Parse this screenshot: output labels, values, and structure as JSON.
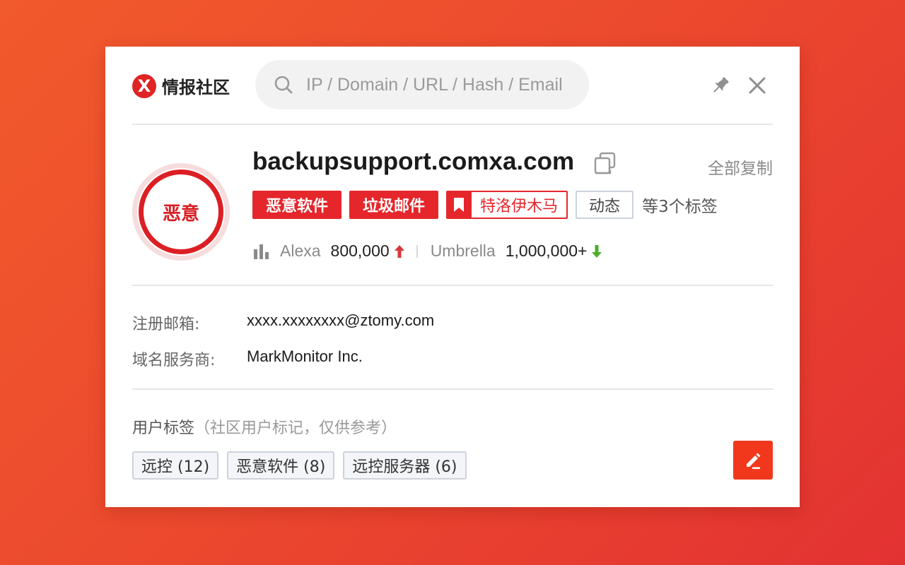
{
  "header": {
    "logo_mark": "X",
    "logo_text": "情报社区",
    "search_placeholder": "IP / Domain / URL / Hash / Email"
  },
  "result": {
    "verdict": "恶意",
    "domain": "backupsupport.comxa.com",
    "copy_all_label": "全部复制",
    "tags": [
      {
        "label": "恶意软件",
        "style": "solid"
      },
      {
        "label": "垃圾邮件",
        "style": "solid"
      },
      {
        "label": "特洛伊木马",
        "style": "bookmark"
      },
      {
        "label": "动态",
        "style": "outline"
      }
    ],
    "more_tags": "等3个标签",
    "rank": {
      "alexa_label": "Alexa",
      "alexa_value": "800,000",
      "alexa_trend": "up",
      "umbrella_label": "Umbrella",
      "umbrella_value": "1,000,000+",
      "umbrella_trend": "down"
    }
  },
  "whois": {
    "email_label": "注册邮箱:",
    "email_value": "xxxx.xxxxxxxx@ztomy.com",
    "registrar_label": "域名服务商:",
    "registrar_value": "MarkMonitor Inc."
  },
  "user_tags": {
    "title": "用户标签",
    "hint": "（社区用户标记，仅供参考）",
    "items": [
      "远控 (12)",
      "恶意软件 (8)",
      "远控服务器 (6)"
    ]
  },
  "colors": {
    "brand_red": "#e5262b",
    "up_arrow": "#d9363e",
    "down_arrow": "#4caf2a",
    "edit_button": "#f2381c"
  }
}
